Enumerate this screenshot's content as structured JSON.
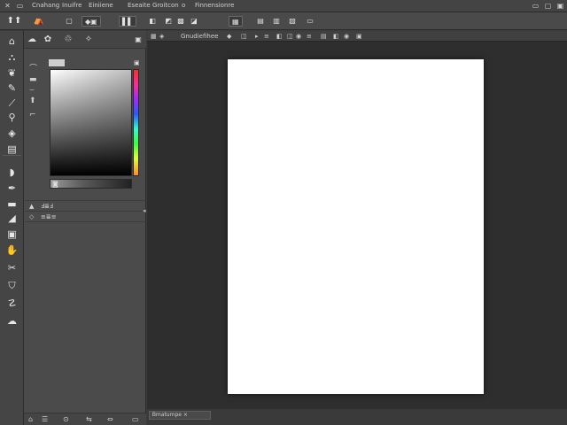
{
  "menubar": {
    "app_icon": "app-logo-icon",
    "items": [
      "Cnahang",
      "Inuifre",
      "Einiiene",
      "Eseaite",
      "Groitcon",
      "o",
      "Finnensionre"
    ],
    "right_icons": [
      "minimize-icon",
      "restore-icon",
      "close-icon"
    ]
  },
  "optionsbar": {
    "tool_preset_icon": "brush-tool-icon",
    "brush_size": "◆",
    "mode_label": "◆▣",
    "buttons": [
      "▌▌",
      "◧",
      "◩",
      "▩",
      "◪",
      "▦",
      "▤",
      "▥",
      "▧"
    ]
  },
  "toolbar": {
    "tools": [
      {
        "name": "home-icon",
        "glyph": "⌂"
      },
      {
        "name": "lasso-icon",
        "glyph": "⛬"
      },
      {
        "name": "quick-select-icon",
        "glyph": "❦"
      },
      {
        "name": "spot-heal-icon",
        "glyph": "✎"
      },
      {
        "name": "brush-icon",
        "glyph": "⟋"
      },
      {
        "name": "clone-stamp-icon",
        "glyph": "⚲"
      },
      {
        "name": "eraser-icon",
        "glyph": "◈"
      },
      {
        "name": "gradient-icon",
        "glyph": "▤"
      },
      {
        "name": "burn-icon",
        "glyph": "◗"
      },
      {
        "name": "pen-icon",
        "glyph": "✒"
      },
      {
        "name": "type-icon",
        "glyph": "▬"
      },
      {
        "name": "shape-icon",
        "glyph": "◢"
      },
      {
        "name": "rectangle-icon",
        "glyph": "▣"
      },
      {
        "name": "hand-icon",
        "glyph": "✋"
      },
      {
        "name": "zoom-icon",
        "glyph": "✂"
      },
      {
        "name": "foreground-color-icon",
        "glyph": "⛉"
      },
      {
        "name": "smudge-icon",
        "glyph": "☡"
      },
      {
        "name": "quick-mask-icon",
        "glyph": "☁"
      }
    ]
  },
  "panel": {
    "tabs": [
      "☁",
      "✿",
      "♲",
      "✧"
    ],
    "tab_names": [
      "cloud-icon",
      "flower-icon",
      "recycle-icon",
      "sparkle-icon"
    ],
    "color_swatch_rows": [
      "⌒",
      "▬",
      "⌣",
      "⬆",
      "⌐"
    ],
    "rows": [
      {
        "icon": "▲",
        "label": "Ⅎ≣Ⅎ"
      },
      {
        "icon": "◇",
        "label": "≡≣≡"
      }
    ],
    "footer_icons": [
      "⌂",
      "☰",
      "⊙",
      "⇆",
      "⇔"
    ]
  },
  "doc": {
    "tab_items": [
      "▦",
      "◈",
      "Gnudiefihee",
      "◆",
      "◫",
      "▸",
      "≡",
      "◧",
      "◫",
      "◉",
      "≡",
      "▤",
      "◧",
      "◉",
      "▣"
    ],
    "canvas_color": "#ffffff",
    "status_label": "Ᏼmatumpe ⨯"
  }
}
